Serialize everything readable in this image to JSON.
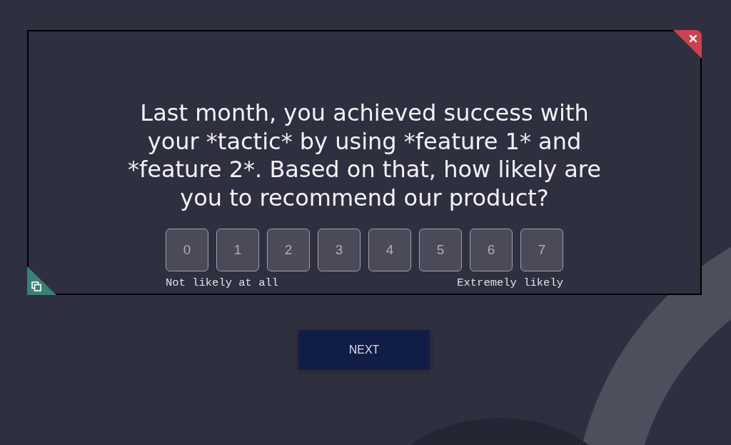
{
  "dialog": {
    "question": "Last month, you achieved success with your *tactic* by using *feature 1* and *feature 2*. Based on that, how likely are you to recommend our product?",
    "scale": {
      "options": [
        {
          "label": "0",
          "selected": false
        },
        {
          "label": "1",
          "selected": false
        },
        {
          "label": "2",
          "selected": false
        },
        {
          "label": "3",
          "selected": false
        },
        {
          "label": "4",
          "selected": false
        },
        {
          "label": "5",
          "selected": false
        },
        {
          "label": "6",
          "selected": false
        },
        {
          "label": "7",
          "selected": false
        }
      ],
      "min_label": "Not likely at all",
      "max_label": "Extremely likely"
    }
  },
  "next_button": {
    "label": "NEXT"
  }
}
